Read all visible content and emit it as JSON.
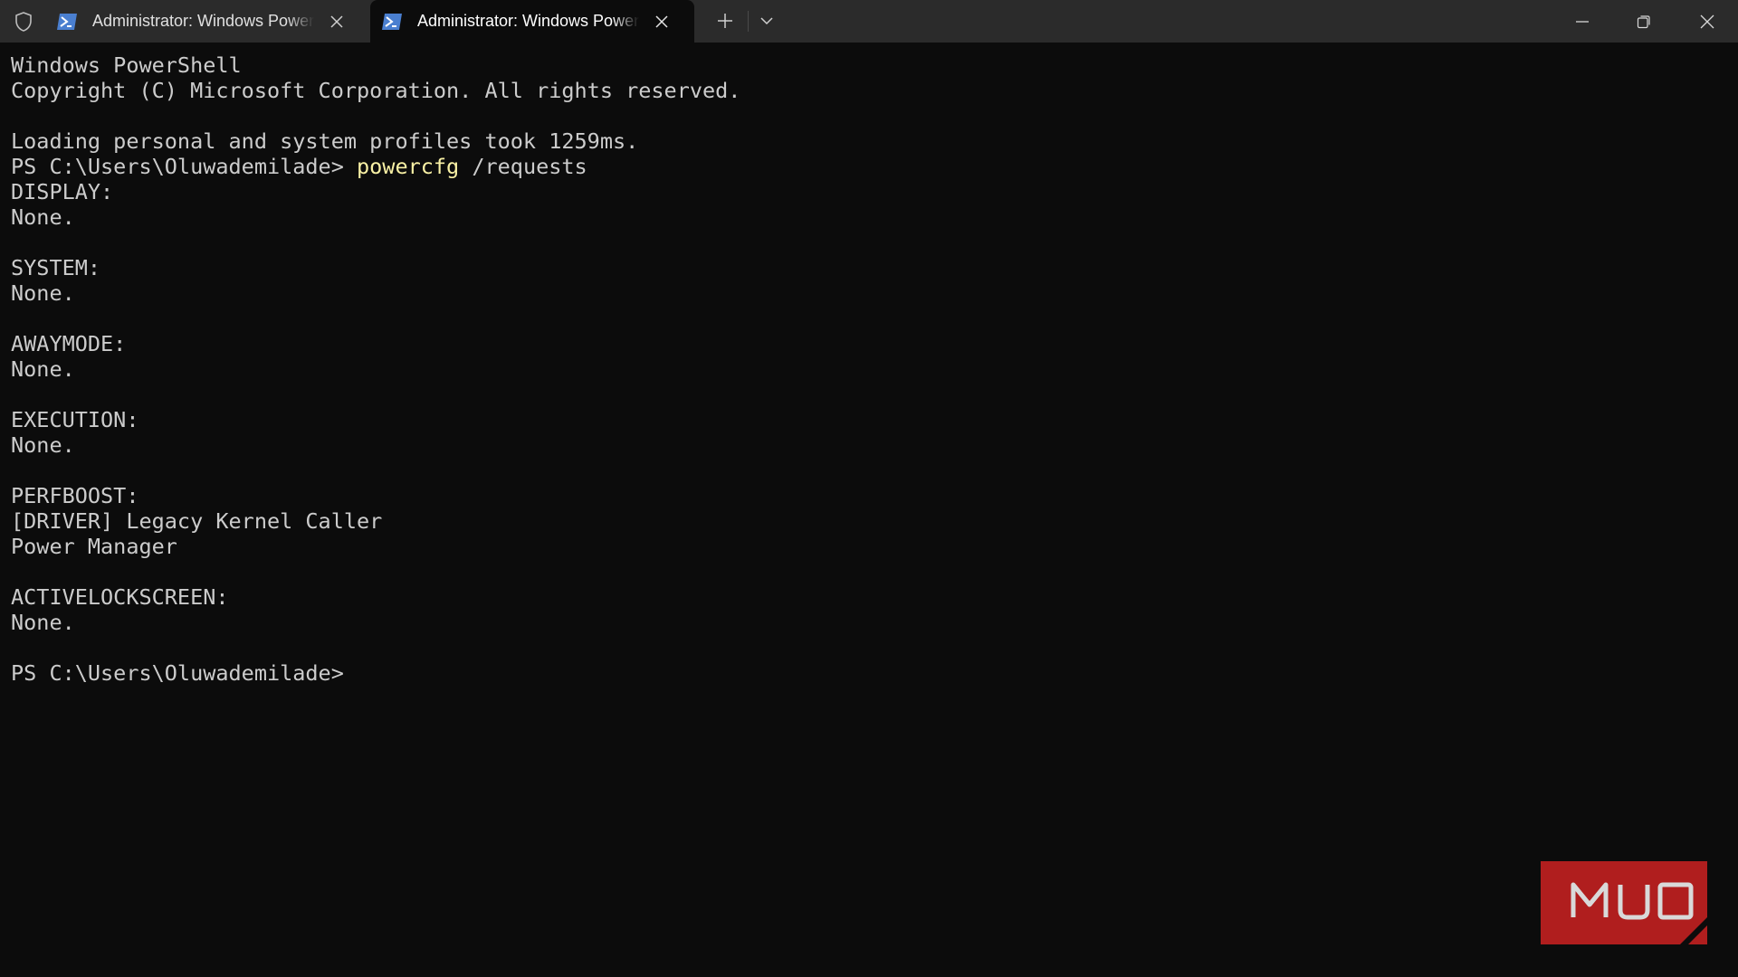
{
  "window": {
    "tabs": [
      {
        "title": "Administrator: Windows PowerShell",
        "icon": "powershell-icon",
        "active": false
      },
      {
        "title": "Administrator: Windows PowerShell",
        "icon": "powershell-icon",
        "active": true
      }
    ],
    "new_tab_glyph": "+",
    "colors": {
      "titlebar": "#2b2b2b",
      "terminal_bg": "#0c0c0c",
      "text": "#cccccc",
      "command": "#f9f1a5",
      "accent_icon": "#4a7fd0"
    }
  },
  "terminal": {
    "header_line1": "Windows PowerShell",
    "header_line2": "Copyright (C) Microsoft Corporation. All rights reserved.",
    "profile_line": "Loading personal and system profiles took 1259ms.",
    "prompt": "PS C:\\Users\\Oluwademilade>",
    "command_name": "powercfg",
    "command_args": "/requests",
    "sections": [
      {
        "heading": "DISPLAY:",
        "lines": [
          "None."
        ]
      },
      {
        "heading": "SYSTEM:",
        "lines": [
          "None."
        ]
      },
      {
        "heading": "AWAYMODE:",
        "lines": [
          "None."
        ]
      },
      {
        "heading": "EXECUTION:",
        "lines": [
          "None."
        ]
      },
      {
        "heading": "PERFBOOST:",
        "lines": [
          "[DRIVER] Legacy Kernel Caller",
          "Power Manager"
        ]
      },
      {
        "heading": "ACTIVELOCKSCREEN:",
        "lines": [
          "None."
        ]
      }
    ],
    "final_prompt": "PS C:\\Users\\Oluwademilade>"
  },
  "watermark": {
    "text": "MUO",
    "color": "#b01e1e"
  }
}
